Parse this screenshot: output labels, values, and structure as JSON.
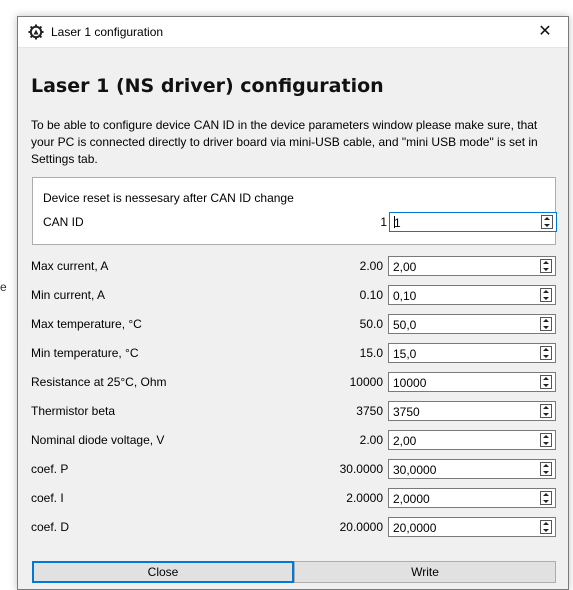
{
  "window": {
    "title": "Laser 1 configuration",
    "close_glyph": "✕",
    "icon": "gear-laser-icon"
  },
  "heading": "Laser 1 (NS driver) configuration",
  "notice": "To be able to configure device CAN ID in the device parameters window please make sure, that your PC is connected directly to driver board via mini-USB cable, and \"mini USB mode\" is set in Settings tab.",
  "can_box": {
    "reset_text": "Device reset is nessesary after CAN ID change",
    "label": "CAN ID",
    "current_value": "1",
    "input_value": "1"
  },
  "params": [
    {
      "label": "Max current, A",
      "value": "2.00",
      "input": "2,00"
    },
    {
      "label": "Min current, A",
      "value": "0.10",
      "input": "0,10"
    },
    {
      "label": "Max temperature, °C",
      "value": "50.0",
      "input": "50,0"
    },
    {
      "label": "Min temperature, °C",
      "value": "15.0",
      "input": "15,0"
    },
    {
      "label": "Resistance at 25°C, Ohm",
      "value": "10000",
      "input": "10000"
    },
    {
      "label": "Thermistor beta",
      "value": "3750",
      "input": "3750"
    },
    {
      "label": "Nominal diode voltage, V",
      "value": "2.00",
      "input": "2,00"
    },
    {
      "label": "coef. P",
      "value": "30.0000",
      "input": "30,0000"
    },
    {
      "label": "coef. I",
      "value": "2.0000",
      "input": "2,0000"
    },
    {
      "label": "coef. D",
      "value": "20.0000",
      "input": "20,0000"
    }
  ],
  "buttons": {
    "close": "Close",
    "write": "Write"
  },
  "backdrop_glyph": "e"
}
